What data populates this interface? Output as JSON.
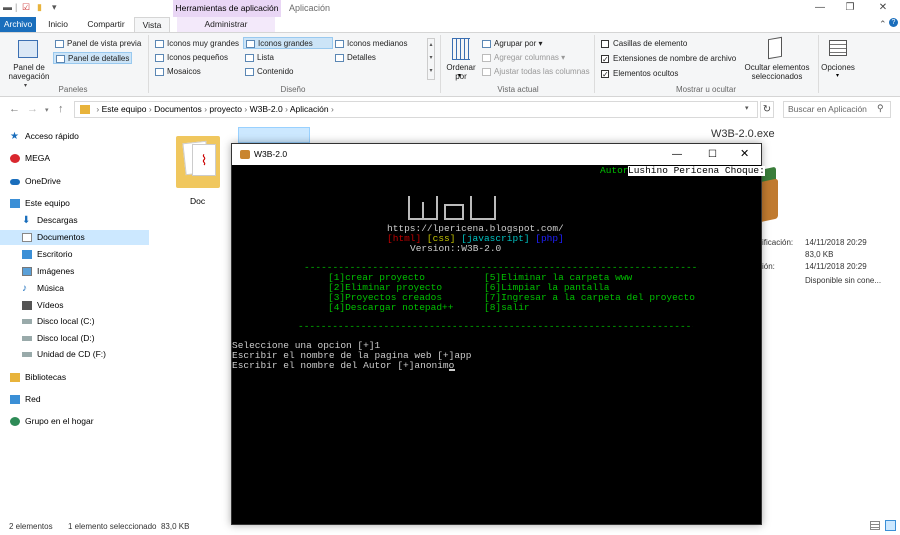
{
  "window": {
    "context_tab": "Herramientas de aplicación",
    "title": "Aplicación"
  },
  "tabs": [
    "Archivo",
    "Inicio",
    "Compartir",
    "Vista",
    "Administrar"
  ],
  "ribbon": {
    "panes": {
      "nav_pane": "Panel de navegación",
      "preview": "Panel de vista previa",
      "details": "Panel de detalles",
      "group": "Paneles"
    },
    "layout": {
      "items": [
        "Iconos muy grandes",
        "Iconos grandes",
        "Iconos medianos",
        "Iconos pequeños",
        "Lista",
        "Detalles",
        "Mosaicos",
        "Contenido"
      ],
      "group": "Diseño"
    },
    "view": {
      "sort": "Ordenar por",
      "group_by": "Agrupar por",
      "add_columns": "Agregar columnas",
      "fit_columns": "Ajustar todas las columnas",
      "group": "Vista actual"
    },
    "show": {
      "checkboxes": "Casillas de elemento",
      "extensions": "Extensiones de nombre de archivo",
      "hidden": "Elementos ocultos",
      "hide_selected": "Ocultar elementos seleccionados",
      "group": "Mostrar u ocultar"
    },
    "options": "Opciones"
  },
  "address": {
    "path": [
      "Este equipo",
      "Documentos",
      "proyecto",
      "W3B-2.0",
      "Aplicación"
    ],
    "search_placeholder": "Buscar en Aplicación"
  },
  "nav": [
    "Acceso rápido",
    "MEGA",
    "OneDrive",
    "Este equipo",
    "Descargas",
    "Documentos",
    "Escritorio",
    "Imágenes",
    "Música",
    "Vídeos",
    "Disco local (C:)",
    "Disco local (D:)",
    "Unidad de CD (F:)",
    "Bibliotecas",
    "Red",
    "Grupo en el hogar"
  ],
  "files": {
    "doc_label": "Doc"
  },
  "details": {
    "name": "W3B-2.0.exe",
    "labels": [
      "ificación:",
      "ión:"
    ],
    "values": [
      "14/11/2018 20:29",
      "83,0 KB",
      "14/11/2018 20:29",
      "Disponible sin cone..."
    ]
  },
  "console": {
    "title": "W3B-2.0",
    "author_label": "Autor",
    "author_name": "Lushino Pericena Choque:",
    "url": "https://lpericena.blogspot.com/",
    "tags": {
      "html": "[html]",
      "css": "[css]",
      "js": "[javascript]",
      "php": "[php]"
    },
    "version": "Version::W3B-2.0",
    "divider": "------------------------------------------------------------------------------",
    "menu": [
      "[1]crear proyecto",
      "[2]Eliminar proyecto",
      "[3]Proyectos creados",
      "[4]Descargar notepad++",
      "[5]Eliminar la carpeta www",
      "[6]Limpiar la pantalla",
      "[7]Ingresar a la carpeta del proyecto",
      "[8]salir"
    ],
    "lines": [
      "Seleccione una opcion [+]1",
      "Escribir el nombre de la pagina web [+]app",
      "Escribir el nombre del Autor [+]anonimo"
    ]
  },
  "status": {
    "count": "2 elementos",
    "selected": "1 elemento seleccionado  83,0 KB"
  }
}
